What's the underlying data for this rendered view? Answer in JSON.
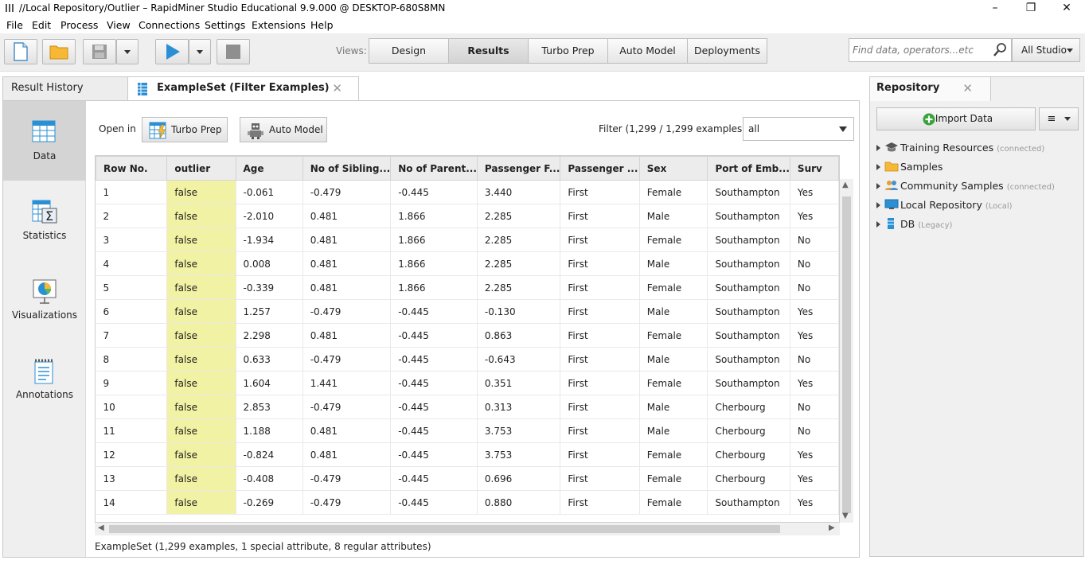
{
  "window": {
    "title": "//Local Repository/Outlier – RapidMiner Studio Educational 9.9.000 @ DESKTOP-680S8MN"
  },
  "menu": [
    "File",
    "Edit",
    "Process",
    "View",
    "Connections",
    "Settings",
    "Extensions",
    "Help"
  ],
  "toolbar": {
    "views_label": "Views:",
    "views": [
      "Design",
      "Results",
      "Turbo Prep",
      "Auto Model",
      "Deployments"
    ],
    "active_view": "Results",
    "search_placeholder": "Find data, operators...etc",
    "studio_select": "All Studio"
  },
  "tabs": {
    "result_history": "Result History",
    "exampleset": "ExampleSet (Filter Examples)"
  },
  "sidenav": [
    "Data",
    "Statistics",
    "Visualizations",
    "Annotations"
  ],
  "data_view": {
    "open_in_label": "Open in",
    "turbo_prep": "Turbo Prep",
    "auto_model": "Auto Model",
    "filter_label": "Filter (1,299 / 1,299 examples):",
    "filter_value": "all",
    "columns": [
      "Row No.",
      "outlier",
      "Age",
      "No of Sibling...",
      "No of Parent...",
      "Passenger F...",
      "Passenger ...",
      "Sex",
      "Port of Emb...",
      "Surv"
    ],
    "rows": [
      [
        "1",
        "false",
        "-0.061",
        "-0.479",
        "-0.445",
        "3.440",
        "First",
        "Female",
        "Southampton",
        "Yes"
      ],
      [
        "2",
        "false",
        "-2.010",
        "0.481",
        "1.866",
        "2.285",
        "First",
        "Male",
        "Southampton",
        "Yes"
      ],
      [
        "3",
        "false",
        "-1.934",
        "0.481",
        "1.866",
        "2.285",
        "First",
        "Female",
        "Southampton",
        "No"
      ],
      [
        "4",
        "false",
        "0.008",
        "0.481",
        "1.866",
        "2.285",
        "First",
        "Male",
        "Southampton",
        "No"
      ],
      [
        "5",
        "false",
        "-0.339",
        "0.481",
        "1.866",
        "2.285",
        "First",
        "Female",
        "Southampton",
        "No"
      ],
      [
        "6",
        "false",
        "1.257",
        "-0.479",
        "-0.445",
        "-0.130",
        "First",
        "Male",
        "Southampton",
        "Yes"
      ],
      [
        "7",
        "false",
        "2.298",
        "0.481",
        "-0.445",
        "0.863",
        "First",
        "Female",
        "Southampton",
        "Yes"
      ],
      [
        "8",
        "false",
        "0.633",
        "-0.479",
        "-0.445",
        "-0.643",
        "First",
        "Male",
        "Southampton",
        "No"
      ],
      [
        "9",
        "false",
        "1.604",
        "1.441",
        "-0.445",
        "0.351",
        "First",
        "Female",
        "Southampton",
        "Yes"
      ],
      [
        "10",
        "false",
        "2.853",
        "-0.479",
        "-0.445",
        "0.313",
        "First",
        "Male",
        "Cherbourg",
        "No"
      ],
      [
        "11",
        "false",
        "1.188",
        "0.481",
        "-0.445",
        "3.753",
        "First",
        "Male",
        "Cherbourg",
        "No"
      ],
      [
        "12",
        "false",
        "-0.824",
        "0.481",
        "-0.445",
        "3.753",
        "First",
        "Female",
        "Cherbourg",
        "Yes"
      ],
      [
        "13",
        "false",
        "-0.408",
        "-0.479",
        "-0.445",
        "0.696",
        "First",
        "Female",
        "Cherbourg",
        "Yes"
      ],
      [
        "14",
        "false",
        "-0.269",
        "-0.479",
        "-0.445",
        "0.880",
        "First",
        "Female",
        "Southampton",
        "Yes"
      ]
    ],
    "status": "ExampleSet (1,299 examples, 1 special attribute, 8 regular attributes)"
  },
  "repository": {
    "title": "Repository",
    "import_data": "Import Data",
    "items": [
      {
        "name": "Training Resources",
        "tag": "(connected)"
      },
      {
        "name": "Samples",
        "tag": ""
      },
      {
        "name": "Community Samples",
        "tag": "(connected)"
      },
      {
        "name": "Local Repository",
        "tag": "(Local)"
      },
      {
        "name": "DB",
        "tag": "(Legacy)"
      }
    ]
  },
  "colors": {
    "special_column": "#f2f2a4",
    "accent_blue": "#2b8fd6"
  }
}
